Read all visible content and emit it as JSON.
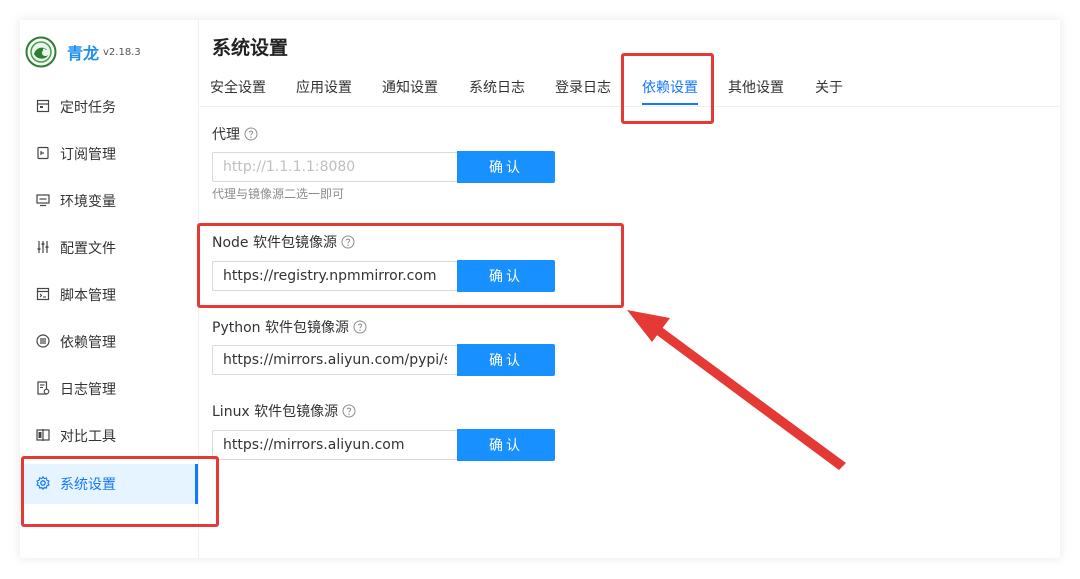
{
  "app": {
    "name": "青龙",
    "version": "v2.18.3"
  },
  "sidebar": {
    "items": [
      {
        "label": "定时任务",
        "icon": "calendar-icon"
      },
      {
        "label": "订阅管理",
        "icon": "subscription-icon"
      },
      {
        "label": "环境变量",
        "icon": "monitor-icon"
      },
      {
        "label": "配置文件",
        "icon": "sliders-icon"
      },
      {
        "label": "脚本管理",
        "icon": "code-file-icon"
      },
      {
        "label": "依赖管理",
        "icon": "package-icon"
      },
      {
        "label": "日志管理",
        "icon": "log-icon"
      },
      {
        "label": "对比工具",
        "icon": "diff-icon"
      },
      {
        "label": "系统设置",
        "icon": "gear-icon",
        "active": true
      }
    ]
  },
  "main": {
    "title": "系统设置",
    "tabs": [
      {
        "label": "安全设置"
      },
      {
        "label": "应用设置"
      },
      {
        "label": "通知设置"
      },
      {
        "label": "系统日志"
      },
      {
        "label": "登录日志"
      },
      {
        "label": "依赖设置",
        "active": true
      },
      {
        "label": "其他设置"
      },
      {
        "label": "关于"
      }
    ],
    "proxy": {
      "label": "代理",
      "value": "",
      "placeholder": "http://1.1.1.1:8080",
      "button": "确认",
      "hint": "代理与镜像源二选一即可"
    },
    "node_mirror": {
      "label": "Node 软件包镜像源",
      "value": "https://registry.npmmirror.com",
      "button": "确认"
    },
    "python_mirror": {
      "label": "Python 软件包镜像源",
      "value": "https://mirrors.aliyun.com/pypi/simple",
      "button": "确认"
    },
    "linux_mirror": {
      "label": "Linux 软件包镜像源",
      "value": "https://mirrors.aliyun.com",
      "button": "确认"
    }
  },
  "colors": {
    "primary": "#1677ff",
    "button": "#1890ff",
    "annotation": "#e53935",
    "active_bg": "#e6f4ff"
  }
}
